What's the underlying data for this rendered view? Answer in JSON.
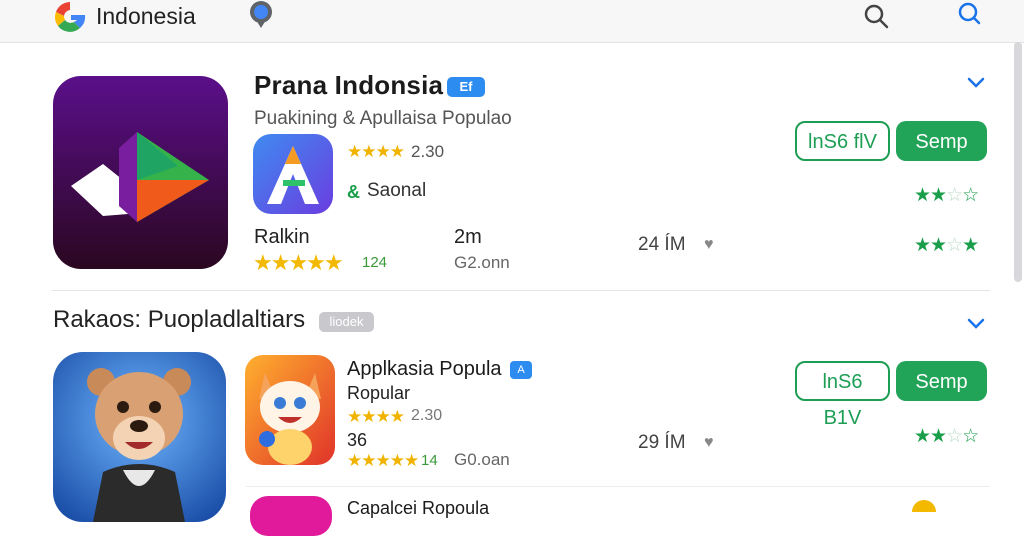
{
  "header": {
    "title": "Indonesia",
    "logo_icon": "google-g-icon",
    "icons": [
      "maps-pin-icon",
      "search-icon",
      "search-icon"
    ]
  },
  "featured": {
    "title": "Prana Indonsia",
    "badge": "Ef",
    "subtitle": "Puakining & Apullaisa Populao",
    "app": {
      "stars": "★★★★",
      "rating": "2.30",
      "developer_icon": "&",
      "developer": "Saonal",
      "install_label": "lnS6 flV",
      "open_label": "Semp",
      "stars_green": "★★"
    },
    "ranking": {
      "label": "Ralkin",
      "stars": "★★★★★",
      "count": "124",
      "size": "2m",
      "domain": "G2.onn",
      "downloads": "24 ÍM",
      "stars_green": "★★"
    }
  },
  "section2": {
    "title": "Rakaos: Puopladlaltiars",
    "badge": "liodek",
    "app": {
      "title": "Applkasia Popula",
      "badge": "A",
      "subtitle": "Ropular",
      "stars": "★★★★",
      "rating": "2.30",
      "number": "36",
      "stars2": "★★★★★",
      "count": "14",
      "domain": "G0.oan",
      "downloads": "29 ÍM",
      "install_label": "lnS6 B1V",
      "open_label": "Semp",
      "stars_green": "★★"
    },
    "next_app_title": "Capalcei Ropoula"
  },
  "colors": {
    "accent_green": "#21a457",
    "star_yellow": "#f0b300",
    "badge_blue": "#2d8cf0"
  }
}
